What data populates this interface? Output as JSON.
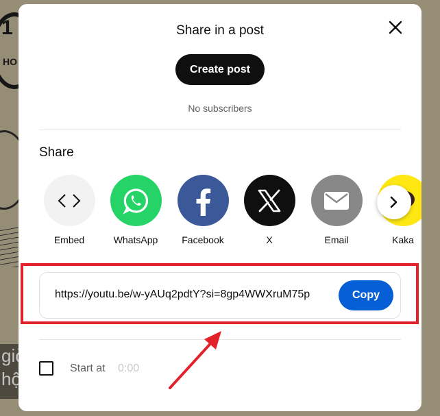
{
  "dialog": {
    "title": "Share in a post",
    "create_post_label": "Create post",
    "subscribers_text": "No subscribers"
  },
  "share": {
    "heading": "Share",
    "items": [
      {
        "label": "Embed",
        "icon": "embed-code-icon",
        "color": "#f2f2f2"
      },
      {
        "label": "WhatsApp",
        "icon": "whatsapp-icon",
        "color": "#25d366"
      },
      {
        "label": "Facebook",
        "icon": "facebook-icon",
        "color": "#3b5998"
      },
      {
        "label": "X",
        "icon": "x-icon",
        "color": "#0f0f0f"
      },
      {
        "label": "Email",
        "icon": "email-icon",
        "color": "#888888"
      },
      {
        "label": "Kaka",
        "icon": "kakaotalk-icon",
        "color": "#ffe812"
      }
    ]
  },
  "link": {
    "url": "https://youtu.be/w-yAUq2pdtY?si=8gp4WWXruM75p",
    "copy_label": "Copy"
  },
  "start_at": {
    "label": "Start at",
    "time": "0:00",
    "checked": false
  },
  "background": {
    "badge_text": "1",
    "badge_sub": "HO",
    "caption_lines": [
      "giờ",
      "hột"
    ]
  },
  "colors": {
    "copy_button": "#065fd4",
    "highlight": "#e3212b",
    "dialog_bg": "#ffffff"
  }
}
